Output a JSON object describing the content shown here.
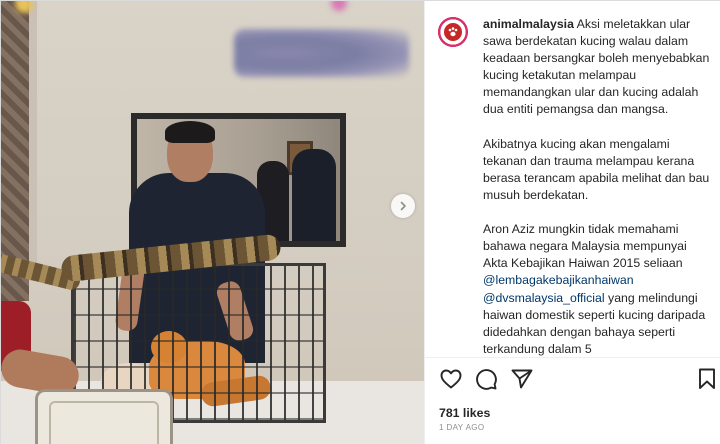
{
  "post": {
    "username": "animalmalaysia",
    "caption_p1": "Aksi meletakkan ular sawa berdekatan kucing walau dalam keadaan bersangkar boleh menyebabkan kucing ketakutan melampau memandangkan ular dan kucing adalah dua entiti pemangsa dan mangsa.",
    "caption_p2": "Akibatnya kucing akan mengalami tekanan dan trauma melampau kerana berasa terancam apabila melihat dan bau musuh berdekatan.",
    "caption_p3": "Aron Aziz mungkin tidak memahami bahawa negara Malaysia mempunyai Akta Kebajikan Haiwan 2015 seliaan",
    "mention_1": "@lembagakebajikanhaiwan",
    "mention_2": "@dvsmalaysia_official",
    "caption_p4": "yang melindungi haiwan domestik seperti kucing daripada didedahkan dengan bahaya seperti terkandung dalam 5",
    "likes": "781 likes",
    "time": "1 DAY AGO"
  },
  "icons": {
    "like": "heart-icon",
    "comment": "comment-icon",
    "share": "paper-plane-icon",
    "save": "bookmark-icon",
    "next": "chevron-right-icon"
  },
  "colors": {
    "text": "#262626",
    "link": "#00376b",
    "muted": "#8e8e8e",
    "border": "#dbdbdb"
  }
}
